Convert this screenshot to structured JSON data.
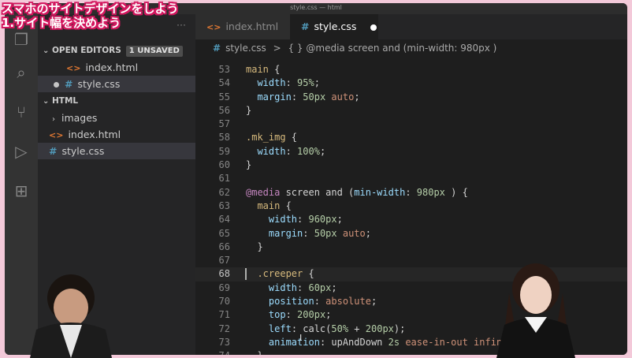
{
  "window": {
    "title": "style.css — html"
  },
  "caption": {
    "line1": "スマホのサイトデザインをしよう",
    "line2": "1.サイト幅を決めよう"
  },
  "sidebar": {
    "more_label": "···",
    "open_editors": {
      "label": "OPEN EDITORS",
      "badge": "1 UNSAVED",
      "files": [
        "index.html",
        "style.css"
      ]
    },
    "folder": {
      "label": "HTML",
      "items": [
        "images",
        "index.html",
        "style.css"
      ]
    }
  },
  "tabs": [
    {
      "label": "index.html",
      "icon": "html-file-icon",
      "active": false
    },
    {
      "label": "style.css",
      "icon": "css-file-icon",
      "active": true,
      "unsaved": true
    }
  ],
  "breadcrumb": {
    "file": "style.css",
    "separator": ">",
    "symbol": "{ } @media screen and (min-width: 980px )"
  },
  "editor": {
    "current_line": 68,
    "lines": [
      {
        "n": "53",
        "text": "main {"
      },
      {
        "n": "54",
        "text": "  width: 95%;"
      },
      {
        "n": "55",
        "text": "  margin: 50px auto;"
      },
      {
        "n": "56",
        "text": "}"
      },
      {
        "n": "57",
        "text": ""
      },
      {
        "n": "58",
        "text": ".mk_img {"
      },
      {
        "n": "59",
        "text": "  width: 100%;"
      },
      {
        "n": "60",
        "text": "}"
      },
      {
        "n": "61",
        "text": ""
      },
      {
        "n": "62",
        "text": "@media screen and (min-width: 980px ) {"
      },
      {
        "n": "63",
        "text": "  main {"
      },
      {
        "n": "64",
        "text": "    width: 960px;"
      },
      {
        "n": "65",
        "text": "    margin: 50px auto;"
      },
      {
        "n": "66",
        "text": "  }"
      },
      {
        "n": "67",
        "text": ""
      },
      {
        "n": "68",
        "text": "  .creeper {"
      },
      {
        "n": "69",
        "text": "    width: 60px;"
      },
      {
        "n": "70",
        "text": "    position: absolute;"
      },
      {
        "n": "71",
        "text": "    top: 200px;"
      },
      {
        "n": "72",
        "text": "    left: calc(50% + 200px);"
      },
      {
        "n": "73",
        "text": "    animation: upAndDown 2s ease-in-out infini"
      },
      {
        "n": "74",
        "text": "  }"
      }
    ]
  },
  "colors": {
    "accent_caption": "#d4175f",
    "editor_bg": "#1e1e1e",
    "sidebar_bg": "#252526",
    "page_bg": "#f3c9d9"
  }
}
